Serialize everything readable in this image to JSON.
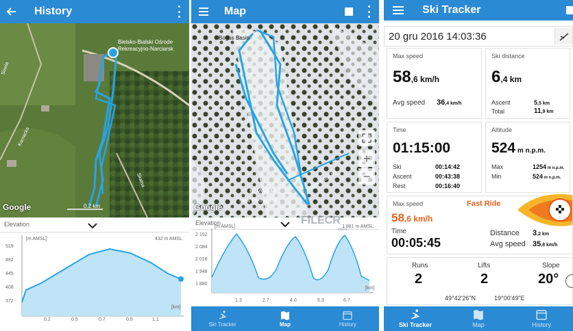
{
  "history": {
    "title": "History",
    "map_labels": {
      "resort_line1": "Bielsko-Bialski Ośrode",
      "resort_line2": "Rekreacyjno-Narciarsk",
      "road1": "Karnacka",
      "road2": "Skalna",
      "scale": "0.2 km",
      "edge": "Sowia"
    },
    "google": "Google",
    "elevation_label": "Elevation",
    "unit": "[m AMSL]",
    "current": "432 m AMSL",
    "y_ticks": [
      "519",
      "482",
      "445",
      "408",
      "372"
    ],
    "x_ticks": [
      "0.2",
      "0.5",
      "0.7",
      "0.9",
      "1.1"
    ],
    "x_unit": "[km]"
  },
  "map": {
    "title": "Map",
    "map_labels": {
      "top": "Bogus Basin",
      "bottom1": "KZMG-FM",
      "bottom2": "New Plymouth",
      "road": "Bogus Basin Rd"
    },
    "google": "Google",
    "elevation_label": "Elevation",
    "unit": "[m AMSL]",
    "current": "1 881 m AMSL",
    "watermark": "FILECR",
    "watermark_sub": ".com",
    "y_ticks": [
      "2 152",
      "2 084",
      "2 016",
      "1 948",
      "1 880"
    ],
    "x_ticks": [
      "1.3",
      "2.7",
      "4.0",
      "5.3",
      "6.7"
    ],
    "x_unit": "[km]"
  },
  "tracker": {
    "title": "Ski Tracker",
    "date": "20 gru 2016 14:03:36",
    "max_speed": {
      "title": "Max speed",
      "value": "58",
      "decimal": ",6 km/h",
      "avg_label": "Avg speed",
      "avg_value": "36",
      "avg_decimal": ",4 km/h"
    },
    "ski_distance": {
      "title": "Ski distance",
      "value": "6",
      "decimal": ",4 km",
      "ascent_label": "Ascent",
      "ascent_value": "5",
      "ascent_decimal": ",5 km",
      "total_label": "Total",
      "total_value": "11",
      "total_decimal": ",9 km"
    },
    "time": {
      "title": "Time",
      "value": "01:15:00",
      "ski_label": "Ski",
      "ski_value": "00:14:42",
      "ascent_label": "Ascent",
      "ascent_value": "00:43:38",
      "rest_label": "Rest",
      "rest_value": "00:16:40"
    },
    "altitude": {
      "title": "Altitude",
      "value": "524",
      "unit": " m n.p.m.",
      "max_label": "Max",
      "max_value": "1254",
      "max_unit": " m n.p.m.",
      "min_label": "Min",
      "min_value": "524",
      "min_unit": " m n.p.m."
    },
    "fast_ride": {
      "title": "Fast Ride",
      "speed_label": "Max speed",
      "speed_value": "58",
      "speed_decimal": ",6 km/h",
      "time_label": "Time",
      "time_value": "00:05:45",
      "distance_label": "Distance",
      "distance_value": "3",
      "distance_decimal": ",2 km",
      "avg_label": "Avg speed",
      "avg_value": "35",
      "avg_decimal": ",8 km/h"
    },
    "runs": {
      "label": "Runs",
      "value": "2"
    },
    "lifts": {
      "label": "Lifts",
      "value": "2"
    },
    "slope": {
      "label": "Slope",
      "value": "20°"
    },
    "lat": "49°42'26\"N",
    "lon": "19°00'49\"E"
  },
  "nav": {
    "tab_tracker": "Ski Tracker",
    "tab_map": "Map",
    "tab_history": "History"
  },
  "colors": {
    "primary": "#2a8ad4",
    "track": "#29a3e6",
    "accent": "#e8631c"
  }
}
